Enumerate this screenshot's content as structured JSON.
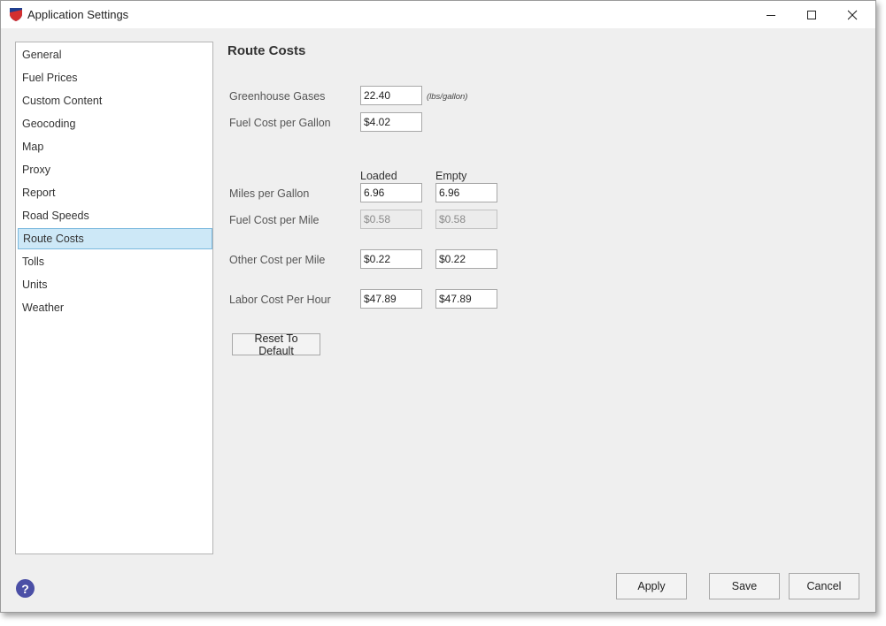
{
  "window": {
    "title": "Application Settings"
  },
  "sidebar": {
    "items": [
      {
        "label": "General"
      },
      {
        "label": "Fuel Prices"
      },
      {
        "label": "Custom Content"
      },
      {
        "label": "Geocoding"
      },
      {
        "label": "Map"
      },
      {
        "label": "Proxy"
      },
      {
        "label": "Report"
      },
      {
        "label": "Road Speeds"
      },
      {
        "label": "Route Costs",
        "selected": true
      },
      {
        "label": "Tolls"
      },
      {
        "label": "Units"
      },
      {
        "label": "Weather"
      }
    ]
  },
  "route_costs": {
    "title": "Route Costs",
    "greenhouse": {
      "label": "Greenhouse Gases",
      "value": "22.40",
      "unit": "(lbs/gallon)"
    },
    "fuel_cost_gallon": {
      "label": "Fuel Cost per Gallon",
      "value": "$4.02"
    },
    "columns": {
      "loaded": "Loaded",
      "empty": "Empty"
    },
    "mpg": {
      "label": "Miles per Gallon",
      "loaded": "6.96",
      "empty": "6.96"
    },
    "fuel_cost_mile": {
      "label": "Fuel Cost per Mile",
      "loaded": "$0.58",
      "empty": "$0.58"
    },
    "other_cost_mile": {
      "label": "Other Cost per Mile",
      "loaded": "$0.22",
      "empty": "$0.22"
    },
    "labor_cost_hour": {
      "label": "Labor Cost Per Hour",
      "loaded": "$47.89",
      "empty": "$47.89"
    },
    "reset_label": "Reset To Default"
  },
  "footer": {
    "help_symbol": "?",
    "apply_label": "Apply",
    "save_label": "Save",
    "cancel_label": "Cancel"
  },
  "colors": {
    "selected_bg": "#cde8f7",
    "selected_border": "#7ab8de",
    "help_icon": "#4b4fa6"
  },
  "icons": [
    "app-shield-icon",
    "minimize-icon",
    "maximize-icon",
    "close-icon",
    "help-icon"
  ]
}
